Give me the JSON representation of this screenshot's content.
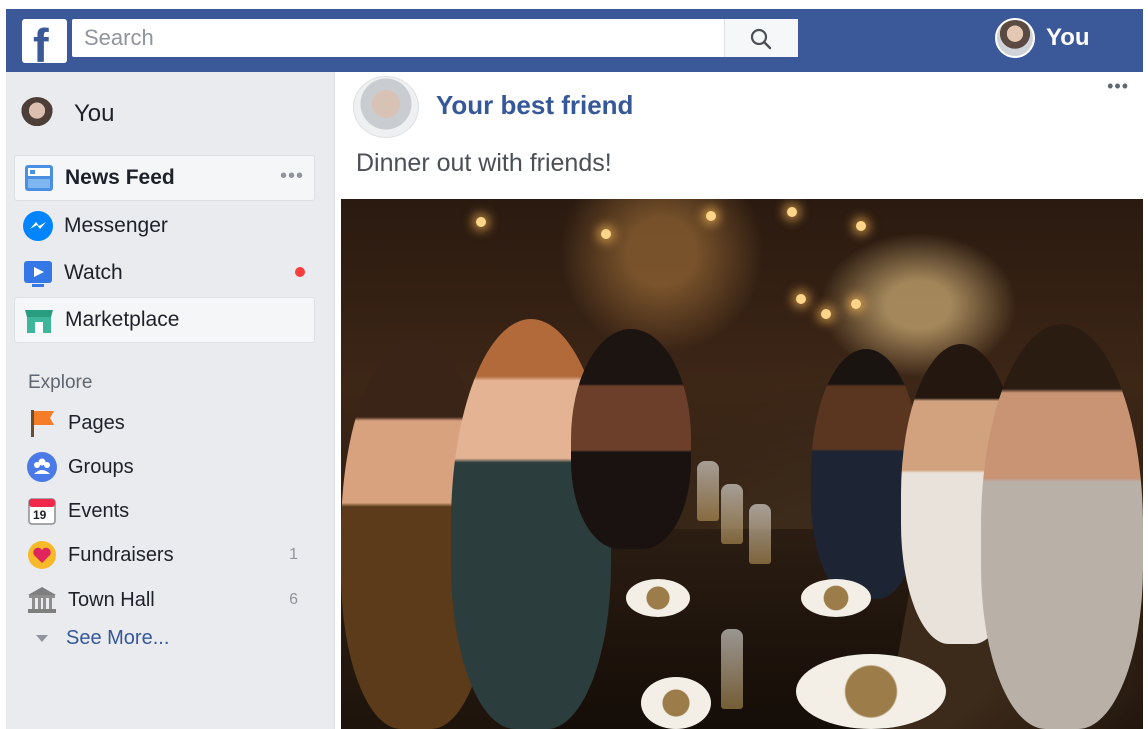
{
  "header": {
    "logo_letter": "f",
    "search_placeholder": "Search",
    "profile_name": "You",
    "brand_color": "#3b5998"
  },
  "sidebar": {
    "user_name": "You",
    "nav_items": [
      {
        "label": "News Feed",
        "icon": "news-feed-icon",
        "active": true,
        "more": "•••"
      },
      {
        "label": "Messenger",
        "icon": "messenger-icon"
      },
      {
        "label": "Watch",
        "icon": "watch-icon",
        "notification_dot": true
      },
      {
        "label": "Marketplace",
        "icon": "marketplace-icon",
        "highlighted": true
      }
    ],
    "explore_title": "Explore",
    "explore_items": [
      {
        "label": "Pages",
        "icon": "flag-icon"
      },
      {
        "label": "Groups",
        "icon": "groups-icon"
      },
      {
        "label": "Events",
        "icon": "calendar-icon",
        "icon_text": "19"
      },
      {
        "label": "Fundraisers",
        "icon": "fundraiser-heart-icon",
        "count": "1"
      },
      {
        "label": "Town Hall",
        "icon": "town-hall-icon",
        "count": "6"
      }
    ],
    "see_more": "See More..."
  },
  "post": {
    "author": "Your best friend",
    "more": "•••",
    "text": "Dinner out with friends!"
  }
}
